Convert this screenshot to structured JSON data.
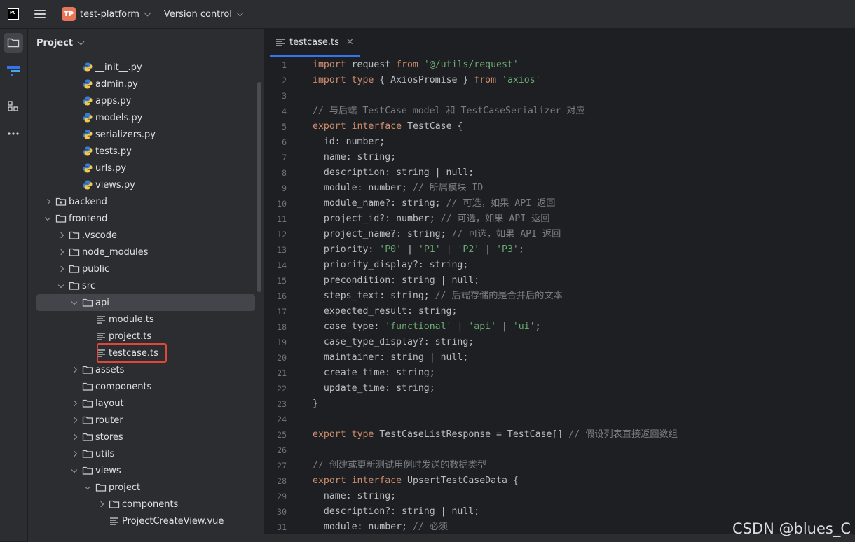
{
  "titlebar": {
    "logo_text": "PC",
    "project_badge": "TP",
    "project_name": "test-platform",
    "vcs_label": "Version control"
  },
  "project_panel": {
    "title": "Project",
    "tree": [
      {
        "label": "__init__.py",
        "type": "py",
        "depth": 3,
        "arrow": "none"
      },
      {
        "label": "admin.py",
        "type": "py",
        "depth": 3,
        "arrow": "none"
      },
      {
        "label": "apps.py",
        "type": "py",
        "depth": 3,
        "arrow": "none"
      },
      {
        "label": "models.py",
        "type": "py",
        "depth": 3,
        "arrow": "none"
      },
      {
        "label": "serializers.py",
        "type": "py",
        "depth": 3,
        "arrow": "none"
      },
      {
        "label": "tests.py",
        "type": "py",
        "depth": 3,
        "arrow": "none"
      },
      {
        "label": "urls.py",
        "type": "py",
        "depth": 3,
        "arrow": "none"
      },
      {
        "label": "views.py",
        "type": "py",
        "depth": 3,
        "arrow": "none"
      },
      {
        "label": "backend",
        "type": "folder-module",
        "depth": 1,
        "arrow": "right"
      },
      {
        "label": "frontend",
        "type": "folder",
        "depth": 1,
        "arrow": "down"
      },
      {
        "label": ".vscode",
        "type": "folder",
        "depth": 2,
        "arrow": "right"
      },
      {
        "label": "node_modules",
        "type": "folder",
        "depth": 2,
        "arrow": "right"
      },
      {
        "label": "public",
        "type": "folder",
        "depth": 2,
        "arrow": "right"
      },
      {
        "label": "src",
        "type": "folder",
        "depth": 2,
        "arrow": "down"
      },
      {
        "label": "api",
        "type": "folder",
        "depth": 3,
        "arrow": "down",
        "selected": true
      },
      {
        "label": "module.ts",
        "type": "ts",
        "depth": 4,
        "arrow": "none"
      },
      {
        "label": "project.ts",
        "type": "ts",
        "depth": 4,
        "arrow": "none"
      },
      {
        "label": "testcase.ts",
        "type": "ts",
        "depth": 4,
        "arrow": "none",
        "highlighted": true
      },
      {
        "label": "assets",
        "type": "folder",
        "depth": 3,
        "arrow": "right"
      },
      {
        "label": "components",
        "type": "folder",
        "depth": 3,
        "arrow": "none"
      },
      {
        "label": "layout",
        "type": "folder",
        "depth": 3,
        "arrow": "right"
      },
      {
        "label": "router",
        "type": "folder",
        "depth": 3,
        "arrow": "right"
      },
      {
        "label": "stores",
        "type": "folder",
        "depth": 3,
        "arrow": "right"
      },
      {
        "label": "utils",
        "type": "folder",
        "depth": 3,
        "arrow": "right"
      },
      {
        "label": "views",
        "type": "folder",
        "depth": 3,
        "arrow": "down"
      },
      {
        "label": "project",
        "type": "folder",
        "depth": 4,
        "arrow": "down"
      },
      {
        "label": "components",
        "type": "folder",
        "depth": 5,
        "arrow": "right"
      },
      {
        "label": "ProjectCreateView.vue",
        "type": "ts",
        "depth": 5,
        "arrow": "none"
      }
    ]
  },
  "editor": {
    "tab_label": "testcase.ts",
    "lines": [
      [
        [
          "kw",
          "import"
        ],
        [
          "t",
          " request "
        ],
        [
          "kw",
          "from"
        ],
        [
          "t",
          " "
        ],
        [
          "str",
          "'@/utils/request'"
        ]
      ],
      [
        [
          "kw",
          "import"
        ],
        [
          "t",
          " "
        ],
        [
          "kw",
          "type"
        ],
        [
          "t",
          " { AxiosPromise } "
        ],
        [
          "kw",
          "from"
        ],
        [
          "t",
          " "
        ],
        [
          "str",
          "'axios'"
        ]
      ],
      [],
      [
        [
          "cm",
          "// 与后端 TestCase model 和 TestCaseSerializer 对应"
        ]
      ],
      [
        [
          "kw",
          "export"
        ],
        [
          "t",
          " "
        ],
        [
          "kw",
          "interface"
        ],
        [
          "t",
          " TestCase {"
        ]
      ],
      [
        [
          "t",
          "  id: number;"
        ]
      ],
      [
        [
          "t",
          "  name: string;"
        ]
      ],
      [
        [
          "t",
          "  description: string | null;"
        ]
      ],
      [
        [
          "t",
          "  module: number; "
        ],
        [
          "cm",
          "// 所属模块 ID"
        ]
      ],
      [
        [
          "t",
          "  module_name?: string; "
        ],
        [
          "cm",
          "// 可选，如果 API 返回"
        ]
      ],
      [
        [
          "t",
          "  project_id?: number; "
        ],
        [
          "cm",
          "// 可选，如果 API 返回"
        ]
      ],
      [
        [
          "t",
          "  project_name?: string; "
        ],
        [
          "cm",
          "// 可选，如果 API 返回"
        ]
      ],
      [
        [
          "t",
          "  priority: "
        ],
        [
          "str",
          "'P0'"
        ],
        [
          "t",
          " | "
        ],
        [
          "str",
          "'P1'"
        ],
        [
          "t",
          " | "
        ],
        [
          "str",
          "'P2'"
        ],
        [
          "t",
          " | "
        ],
        [
          "str",
          "'P3'"
        ],
        [
          "t",
          ";"
        ]
      ],
      [
        [
          "t",
          "  priority_display?: string;"
        ]
      ],
      [
        [
          "t",
          "  precondition: string | null;"
        ]
      ],
      [
        [
          "t",
          "  steps_text: string; "
        ],
        [
          "cm",
          "// 后端存储的是合并后的文本"
        ]
      ],
      [
        [
          "t",
          "  expected_result: string;"
        ]
      ],
      [
        [
          "t",
          "  case_type: "
        ],
        [
          "str",
          "'functional'"
        ],
        [
          "t",
          " | "
        ],
        [
          "str",
          "'api'"
        ],
        [
          "t",
          " | "
        ],
        [
          "str",
          "'ui'"
        ],
        [
          "t",
          ";"
        ]
      ],
      [
        [
          "t",
          "  case_type_display?: string;"
        ]
      ],
      [
        [
          "t",
          "  maintainer: string | null;"
        ]
      ],
      [
        [
          "t",
          "  create_time: string;"
        ]
      ],
      [
        [
          "t",
          "  update_time: string;"
        ]
      ],
      [
        [
          "t",
          "}"
        ]
      ],
      [],
      [
        [
          "kw",
          "export"
        ],
        [
          "t",
          " "
        ],
        [
          "kw",
          "type"
        ],
        [
          "t",
          " TestCaseListResponse = TestCase[] "
        ],
        [
          "cm",
          "// 假设列表直接返回数组"
        ]
      ],
      [],
      [
        [
          "cm",
          "// 创建或更新测试用例时发送的数据类型"
        ]
      ],
      [
        [
          "kw",
          "export"
        ],
        [
          "t",
          " "
        ],
        [
          "kw",
          "interface"
        ],
        [
          "t",
          " UpsertTestCaseData {"
        ]
      ],
      [
        [
          "t",
          "  name: string;"
        ]
      ],
      [
        [
          "t",
          "  description?: string | null;"
        ]
      ],
      [
        [
          "t",
          "  module: number; "
        ],
        [
          "cm",
          "// 必须"
        ]
      ]
    ]
  },
  "watermark": "CSDN @blues_C"
}
